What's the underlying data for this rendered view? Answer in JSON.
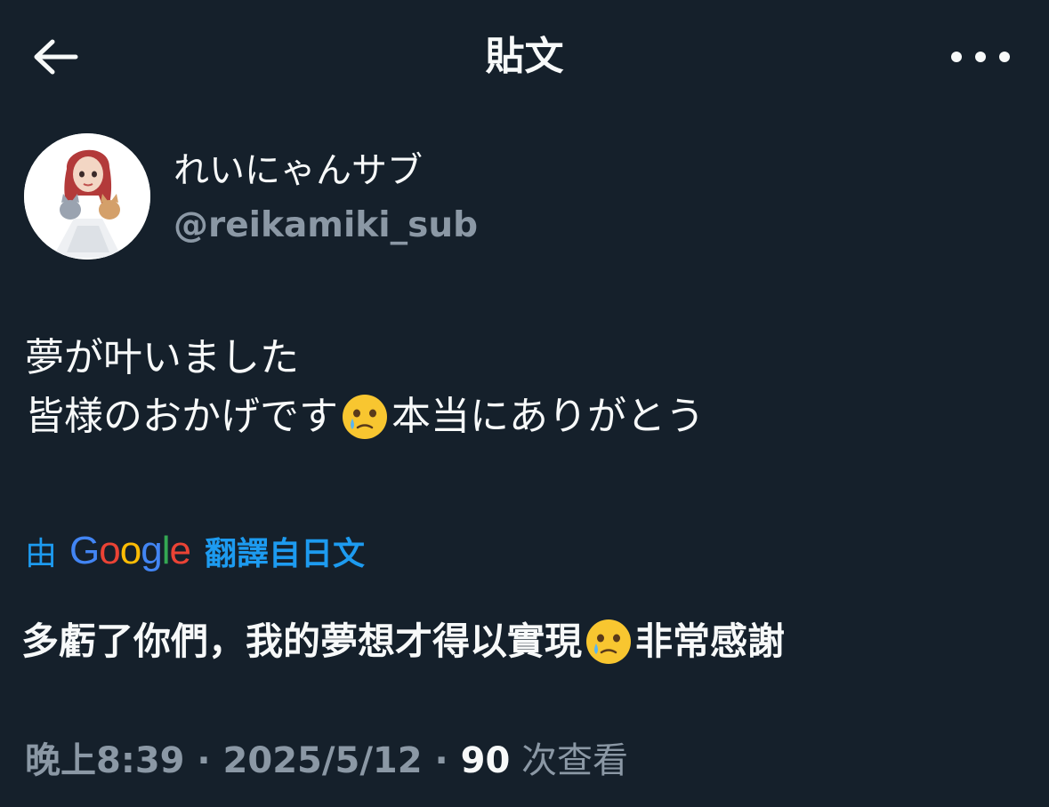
{
  "header": {
    "title": "貼文",
    "back_icon": "arrow-left-icon",
    "more_icon": "more-horizontal-icon"
  },
  "author": {
    "display_name": "れいにゃんサブ",
    "handle": "@reikamiki_sub"
  },
  "tweet": {
    "line1": "夢が叶いました",
    "line2_before": "皆様のおかげです",
    "line2_after": "本当にありがとう",
    "emoji": "face-holding-back-tears"
  },
  "translation": {
    "by_label": "由",
    "google_letters": [
      "G",
      "o",
      "o",
      "g",
      "l",
      "e"
    ],
    "from_label": "翻譯自日文",
    "text_before": "多虧了你們，我的夢想才得以實現",
    "text_after": "非常感謝"
  },
  "meta": {
    "time": "晚上8:39",
    "separator": " · ",
    "date": "2025/5/12",
    "views_count": "90",
    "views_label": " 次查看"
  },
  "colors": {
    "background": "#15202b",
    "primary_text": "#f7f9f9",
    "secondary_text": "#8b98a5",
    "link": "#1d9bf0",
    "google_blue": "#4285f4",
    "google_red": "#ea4335",
    "google_yellow": "#fbbc05",
    "google_green": "#34a853"
  }
}
